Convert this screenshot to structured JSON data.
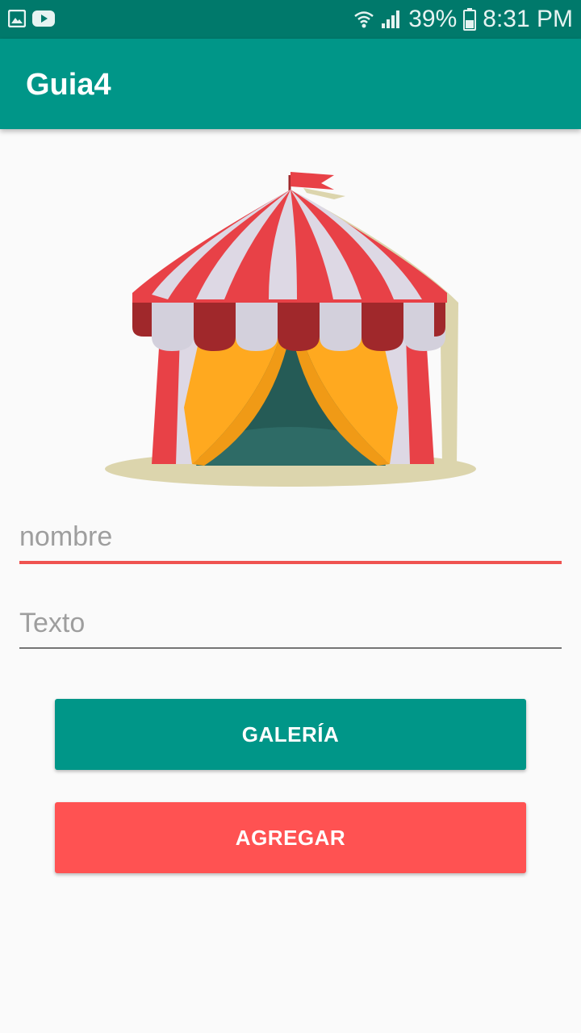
{
  "status_bar": {
    "battery": "39%",
    "time": "8:31 PM",
    "icons": [
      "image-icon",
      "youtube-icon",
      "wifi-icon",
      "signal-icon",
      "battery-icon"
    ]
  },
  "app_bar": {
    "title": "Guia4"
  },
  "hero": {
    "icon": "circus-tent-icon"
  },
  "form": {
    "nombre_placeholder": "nombre",
    "texto_placeholder": "Texto"
  },
  "buttons": {
    "galeria": "GALERÍA",
    "agregar": "AGREGAR"
  },
  "colors": {
    "primary": "#009688",
    "primary_dark": "#00796b",
    "accent": "#ff5252"
  }
}
